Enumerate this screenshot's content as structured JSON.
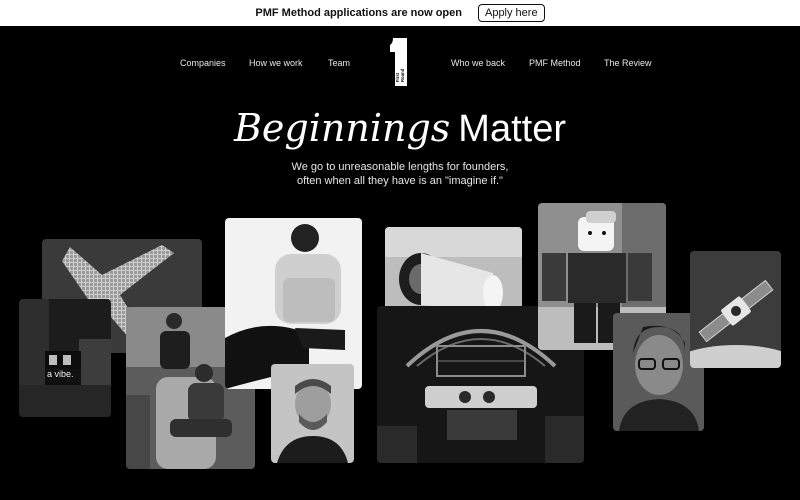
{
  "banner": {
    "text": "PMF Method applications are now open",
    "button_label": "Apply here"
  },
  "nav": {
    "left": [
      "Companies",
      "How we work",
      "Team"
    ],
    "right": [
      "Who we back",
      "PMF Method",
      "The Review"
    ]
  },
  "logo": {
    "glyph": "1",
    "text_line1": "First",
    "text_line2": "Round"
  },
  "hero": {
    "title_italic": "Beginnings",
    "title_regular": "Matter",
    "subtitle_line1": "We go to unreasonable lengths for founders,",
    "subtitle_line2": "often when all they have is an \"imagine if.\""
  },
  "photos": {
    "street_sign_text": "a vibe."
  }
}
